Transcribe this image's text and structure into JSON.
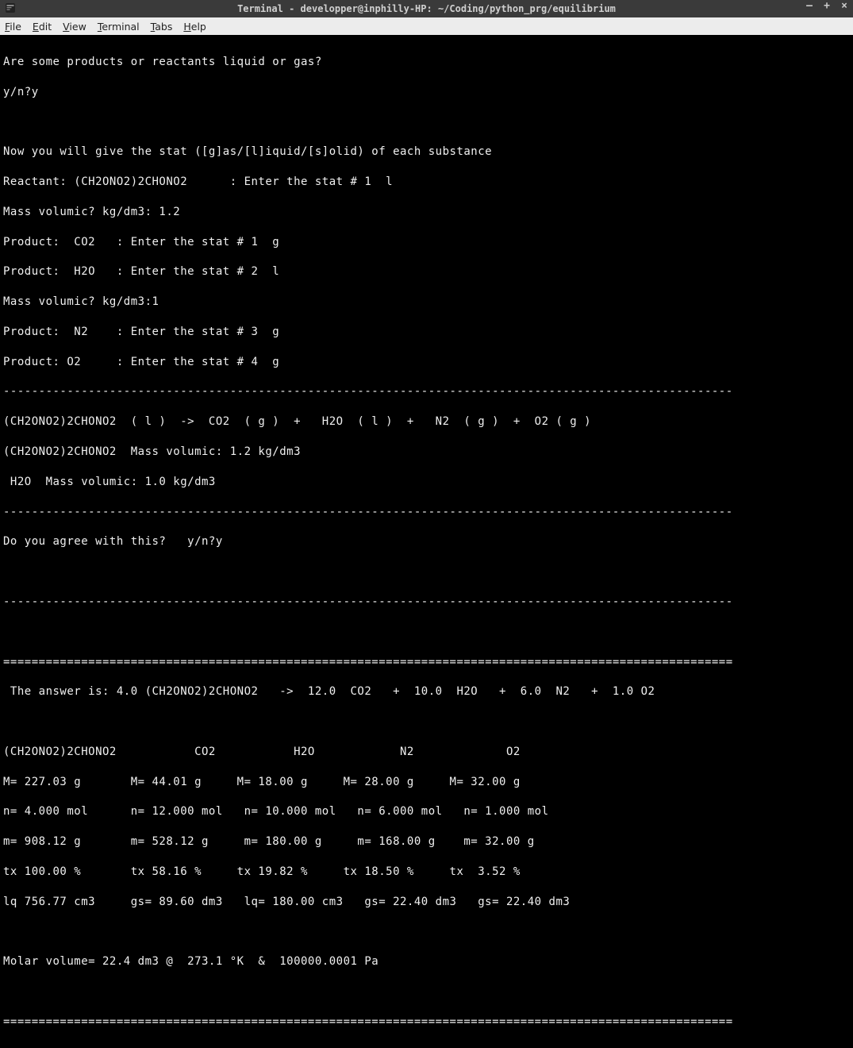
{
  "window": {
    "title": "Terminal - developper@inphilly-HP: ~/Coding/python_prg/equilibrium",
    "controls": {
      "min": "–",
      "max": "+",
      "close": "×"
    }
  },
  "menu": {
    "file": "File",
    "edit": "Edit",
    "view": "View",
    "terminal": "Terminal",
    "tabs": "Tabs",
    "help": "Help"
  },
  "term": {
    "l1": "Are some products or reactants liquid or gas?",
    "l2": "y/n?y",
    "l3": "",
    "l4": "Now you will give the stat ([g]as/[l]iquid/[s]olid) of each substance",
    "l5": "Reactant: (CH2ONO2)2CHONO2      : Enter the stat # 1  l",
    "l6": "Mass volumic? kg/dm3: 1.2",
    "l7": "Product:  CO2   : Enter the stat # 1  g",
    "l8": "Product:  H2O   : Enter the stat # 2  l",
    "l9": "Mass volumic? kg/dm3:1",
    "l10": "Product:  N2    : Enter the stat # 3  g",
    "l11": "Product: O2     : Enter the stat # 4  g",
    "l12": "-------------------------------------------------------------------------------------------------------",
    "l13": "(CH2ONO2)2CHONO2  ( l )  ->  CO2  ( g )  +   H2O  ( l )  +   N2  ( g )  +  O2 ( g )",
    "l14": "(CH2ONO2)2CHONO2  Mass volumic: 1.2 kg/dm3",
    "l15": " H2O  Mass volumic: 1.0 kg/dm3",
    "l16": "-------------------------------------------------------------------------------------------------------",
    "l17": "Do you agree with this?   y/n?y",
    "l18": "",
    "l19": "-------------------------------------------------------------------------------------------------------",
    "l20": "",
    "l21": "=======================================================================================================",
    "l22": " The answer is: 4.0 (CH2ONO2)2CHONO2   ->  12.0  CO2   +  10.0  H2O   +  6.0  N2   +  1.0 O2",
    "l23": "",
    "l24": "(CH2ONO2)2CHONO2           CO2           H2O            N2             O2",
    "l25": "M= 227.03 g       M= 44.01 g     M= 18.00 g     M= 28.00 g     M= 32.00 g",
    "l26": "n= 4.000 mol      n= 12.000 mol   n= 10.000 mol   n= 6.000 mol   n= 1.000 mol",
    "l27": "m= 908.12 g       m= 528.12 g     m= 180.00 g     m= 168.00 g    m= 32.00 g",
    "l28": "tx 100.00 %       tx 58.16 %     tx 19.82 %     tx 18.50 %     tx  3.52 %",
    "l29": "lq 756.77 cm3     gs= 89.60 dm3   lq= 180.00 cm3   gs= 22.40 dm3   gs= 22.40 dm3",
    "l30": "",
    "l31": "Molar volume= 22.4 dm3 @  273.1 °K  &  100000.0001 Pa",
    "l32": "",
    "l33": "======================================================================================================="
  }
}
